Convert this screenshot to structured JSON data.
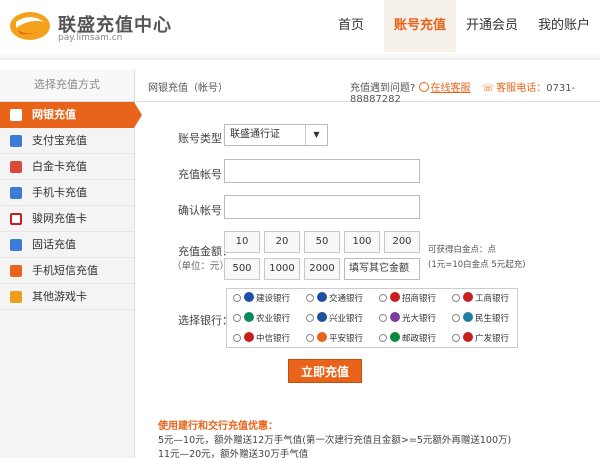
{
  "header": {
    "site_name": "联盛充值中心",
    "site_url": "pay.limsam.cn",
    "nav": [
      "首页",
      "账号充值",
      "开通会员",
      "我的账户"
    ],
    "active_nav": 1
  },
  "sidebar": {
    "heading": "选择充值方式",
    "items": [
      {
        "label": "网银充值",
        "color": "#e8641b"
      },
      {
        "label": "支付宝充值",
        "color": "#3a7bd5"
      },
      {
        "label": "白金卡充值",
        "color": "#d84a3a"
      },
      {
        "label": "手机卡充值",
        "color": "#3a7bd5"
      },
      {
        "label": "骏网充值卡",
        "color": "#c81f1f"
      },
      {
        "label": "固话充值",
        "color": "#3a7bd5"
      },
      {
        "label": "手机短信充值",
        "color": "#e8641b"
      },
      {
        "label": "其他游戏卡",
        "color": "#e8a01b"
      }
    ]
  },
  "breadcrumb": "网银充值（帐号）",
  "help": {
    "question": "充值遇到问题?",
    "online": "在线客服",
    "phone_label": "客服电话：",
    "phone": "0731-88887282"
  },
  "form": {
    "account_type_label": "账号类型：",
    "account_type_value": "联盛通行证",
    "account_label": "充值帐号：",
    "confirm_label": "确认帐号：",
    "amount_label": "充值金额：",
    "amount_unit": "（单位：元）",
    "amounts_row1": [
      "10",
      "20",
      "50",
      "100",
      "200"
    ],
    "amounts_row2": [
      "500",
      "1000",
      "2000"
    ],
    "custom_amount": "填写其它金额",
    "bonus_note_1": "可获得白金点：点",
    "bonus_note_2": "(1元=10白金点   5元起充)",
    "bank_label": "选择银行：",
    "banks": [
      {
        "name": "建设银行",
        "color": "#1e4fa0"
      },
      {
        "name": "交通银行",
        "color": "#1e4fa0"
      },
      {
        "name": "招商银行",
        "color": "#c81f1f"
      },
      {
        "name": "工商银行",
        "color": "#c81f1f"
      },
      {
        "name": "农业银行",
        "color": "#0a8a5a"
      },
      {
        "name": "兴业银行",
        "color": "#1e4fa0"
      },
      {
        "name": "光大银行",
        "color": "#7a3aa0"
      },
      {
        "name": "民生银行",
        "color": "#1e7fa0"
      },
      {
        "name": "中信银行",
        "color": "#c81f1f"
      },
      {
        "name": "平安银行",
        "color": "#e8641b"
      },
      {
        "name": "邮政银行",
        "color": "#0a8a3a"
      },
      {
        "name": "广发银行",
        "color": "#c81f1f"
      }
    ],
    "submit": "立即充值"
  },
  "promo": {
    "title": "使用建行和交行充值优惠：",
    "lines": [
      "5元—10元，额外赠送12万手气值(第一次建行充值且金额>=5元额外再赠送100万)",
      "11元—20元，额外赠送30万手气值"
    ]
  }
}
